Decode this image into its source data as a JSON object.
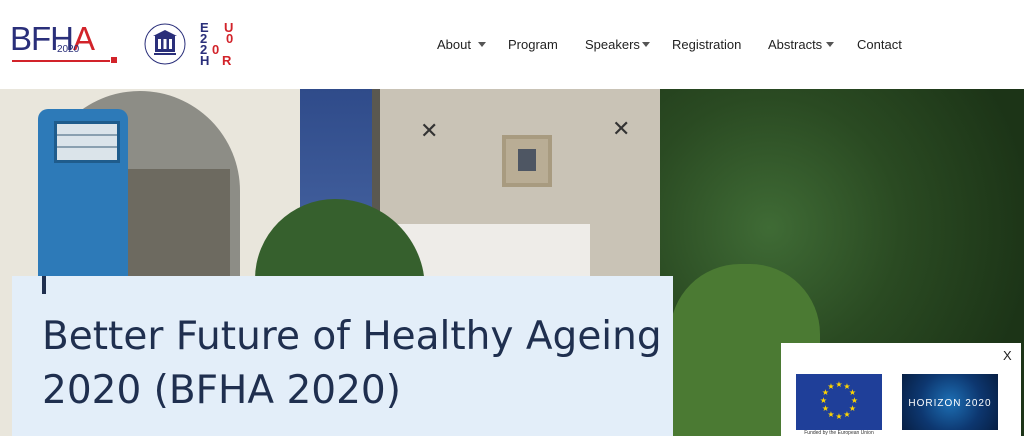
{
  "header": {
    "logo": {
      "word_main": "BFH",
      "word_accent": "A",
      "year": "2020"
    },
    "seal_logo": {
      "icon": "university-seal-icon",
      "color": "#2a2f7a"
    },
    "eu_logo": {
      "lines": [
        {
          "left": "E",
          "right": "U"
        },
        {
          "left": "2",
          "right": "0"
        },
        {
          "left": "2",
          "right": "0"
        },
        {
          "left": "H",
          "right": "R"
        }
      ]
    },
    "nav": [
      {
        "label": "About",
        "has_dropdown": true
      },
      {
        "label": "Program",
        "has_dropdown": false
      },
      {
        "label": "Speakers",
        "has_dropdown": true
      },
      {
        "label": "Registration",
        "has_dropdown": false
      },
      {
        "label": "Abstracts",
        "has_dropdown": true
      },
      {
        "label": "Contact",
        "has_dropdown": false
      }
    ]
  },
  "hero": {
    "title": "Better Future of Healthy Ageing 2020 (BFHA 2020)"
  },
  "funding_popup": {
    "close_label": "X",
    "eu_caption": "Funded by the European Union",
    "horizon_label": "HORIZON 2020"
  },
  "colors": {
    "brand_blue": "#2a2f7a",
    "brand_red": "#d2232a",
    "title_box": "#e3eef9",
    "title_text": "#1f2f4f"
  }
}
